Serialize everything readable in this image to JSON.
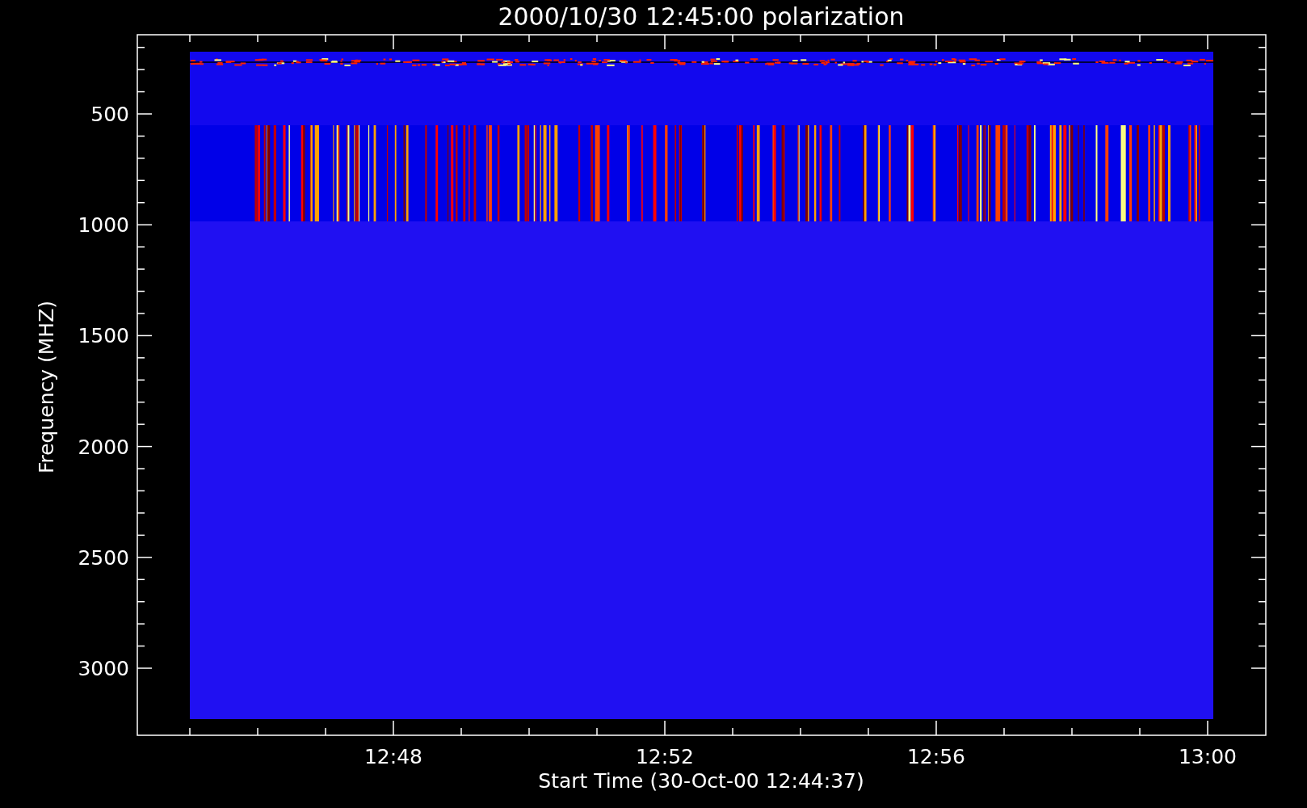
{
  "title": "2000/10/30 12:45:00 polarization",
  "y_axis": {
    "label": "Frequency (MHZ)",
    "ticks": [
      "500",
      "1000",
      "1500",
      "2000",
      "2500",
      "3000"
    ]
  },
  "x_axis": {
    "label": "Start Time (30-Oct-00 12:44:37)",
    "ticks": [
      "12:48",
      "12:52",
      "12:56",
      "13:00"
    ]
  }
}
